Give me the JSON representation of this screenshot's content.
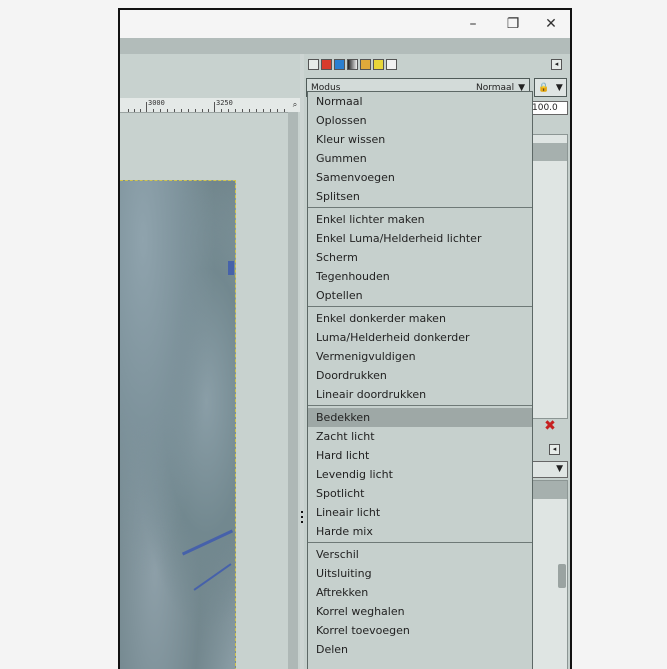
{
  "window": {
    "controls": {
      "minimize": "–",
      "maximize": "❐",
      "close": "✕"
    }
  },
  "ruler": {
    "labels": [
      "3000",
      "3250"
    ]
  },
  "dock": {
    "modus_label": "Modus",
    "modus_value": "Normaal",
    "opacity_value": "100.0"
  },
  "mode_menu": {
    "groups": [
      [
        "Normaal",
        "Oplossen",
        "Kleur wissen",
        "Gummen",
        "Samenvoegen",
        "Splitsen"
      ],
      [
        "Enkel lichter maken",
        "Enkel Luma/Helderheid lichter",
        "Scherm",
        "Tegenhouden",
        "Optellen"
      ],
      [
        "Enkel donkerder maken",
        "Luma/Helderheid donkerder",
        "Vermenigvuldigen",
        "Doordrukken",
        "Lineair doordrukken"
      ],
      [
        "Bedekken",
        "Zacht licht",
        "Hard licht",
        "Levendig licht",
        "Spotlicht",
        "Lineair licht",
        "Harde mix"
      ],
      [
        "Verschil",
        "Uitsluiting",
        "Aftrekken",
        "Korrel weghalen",
        "Korrel toevoegen",
        "Delen"
      ]
    ],
    "selected": "Bedekken"
  },
  "colors": {
    "panel": "#c6d0cd",
    "selection": "#9ea8a6",
    "delete": "#c62020"
  },
  "icons": [
    "pointer-icon",
    "brush-icon",
    "paths-icon",
    "channels-icon",
    "palette-icon",
    "pattern-icon",
    "document-icon",
    "lock-icon",
    "delete-icon"
  ]
}
